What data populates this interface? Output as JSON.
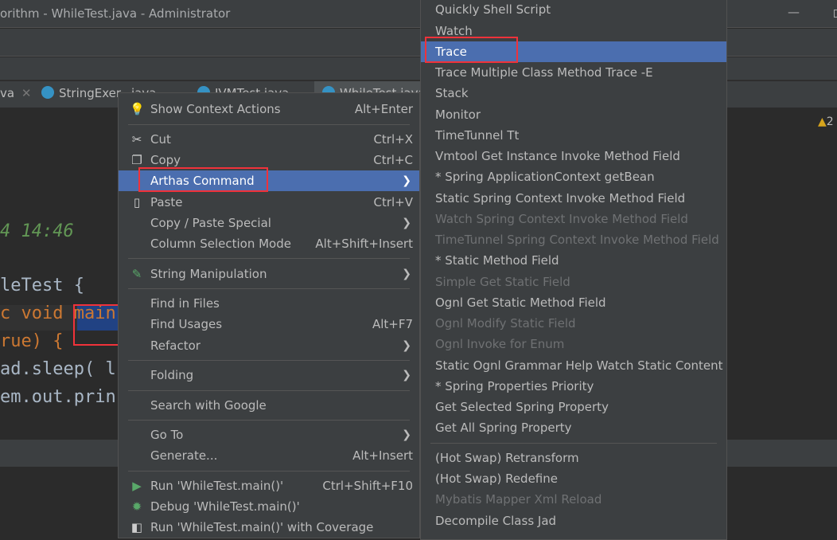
{
  "window": {
    "title": "orithm - WhileTest.java - Administrator",
    "minimize": "—"
  },
  "tabs": [
    {
      "label": "va",
      "close": "✕"
    },
    {
      "label": "StringExer...java",
      "close": "✕"
    },
    {
      "label": "JVMTest.java",
      "close": "✕"
    },
    {
      "label": "WhileTest.java"
    }
  ],
  "editor": {
    "warning_count": "2",
    "lines": [
      {
        "text": "4 14:46",
        "color": "#629755"
      },
      {
        "text": "leTest {",
        "color": "#a9b7c6"
      },
      {
        "text": "c void main",
        "color": "#cc7832"
      },
      {
        "text": "rue) {",
        "color": "#cc7832"
      },
      {
        "text": "ad.sleep( l",
        "color": "#a9b7c6"
      },
      {
        "text": "em.out.prin",
        "color": "#a9b7c6"
      }
    ]
  },
  "context_menu": {
    "items": [
      {
        "label": "Show Context Actions",
        "shortcut": "Alt+Enter",
        "icon": "lightbulb-icon"
      },
      {
        "separator": true
      },
      {
        "label": "Cut",
        "shortcut": "Ctrl+X",
        "icon": "scissors-icon"
      },
      {
        "label": "Copy",
        "shortcut": "Ctrl+C",
        "icon": "copy-icon"
      },
      {
        "label": "Arthas Command",
        "submenu": true,
        "selected": true
      },
      {
        "label": "Paste",
        "shortcut": "Ctrl+V",
        "icon": "clipboard-icon"
      },
      {
        "label": "Copy / Paste Special",
        "submenu": true
      },
      {
        "label": "Column Selection Mode",
        "shortcut": "Alt+Shift+Insert"
      },
      {
        "separator": true
      },
      {
        "label": "String Manipulation",
        "submenu": true,
        "icon": "pencil-icon"
      },
      {
        "separator": true
      },
      {
        "label": "Find in Files"
      },
      {
        "label": "Find Usages",
        "shortcut": "Alt+F7"
      },
      {
        "label": "Refactor",
        "submenu": true
      },
      {
        "separator": true
      },
      {
        "label": "Folding",
        "submenu": true
      },
      {
        "separator": true
      },
      {
        "label": "Search with Google"
      },
      {
        "separator": true
      },
      {
        "label": "Go To",
        "submenu": true
      },
      {
        "label": "Generate...",
        "shortcut": "Alt+Insert"
      },
      {
        "separator": true
      },
      {
        "label": "Run 'WhileTest.main()'",
        "shortcut": "Ctrl+Shift+F10",
        "icon": "run-icon"
      },
      {
        "label": "Debug 'WhileTest.main()'",
        "icon": "debug-icon"
      },
      {
        "label": "Run 'WhileTest.main()' with Coverage",
        "icon": "coverage-icon"
      }
    ]
  },
  "arthas_submenu": {
    "items": [
      {
        "label": "Quickly Shell Script"
      },
      {
        "label": "Watch"
      },
      {
        "label": "Trace",
        "selected": true
      },
      {
        "label": "Trace Multiple Class Method Trace -E"
      },
      {
        "label": "Stack"
      },
      {
        "label": "Monitor"
      },
      {
        "label": "TimeTunnel Tt"
      },
      {
        "label": "Vmtool Get Instance Invoke Method Field"
      },
      {
        "label": "* Spring ApplicationContext getBean"
      },
      {
        "label": "Static Spring Context Invoke  Method Field"
      },
      {
        "label": "Watch Spring Context Invoke Method Field",
        "disabled": true
      },
      {
        "label": "TimeTunnel Spring Context Invoke Method Field",
        "disabled": true
      },
      {
        "label": "*  Static Method Field"
      },
      {
        "label": "Simple Get Static Field",
        "disabled": true
      },
      {
        "label": "Ognl Get Static Method Field"
      },
      {
        "label": "Ognl Modify Static Field",
        "disabled": true
      },
      {
        "label": "Ognl Invoke for Enum",
        "disabled": true
      },
      {
        "label": "Static Ognl Grammar Help Watch Static Content"
      },
      {
        "label": "*  Spring Properties Priority"
      },
      {
        "label": "Get Selected Spring Property"
      },
      {
        "label": "Get All Spring Property"
      },
      {
        "separator": true
      },
      {
        "label": "(Hot Swap) Retransform"
      },
      {
        "label": "(Hot Swap) Redefine"
      },
      {
        "label": "Mybatis Mapper Xml Reload",
        "disabled": true
      },
      {
        "label": "Decompile Class Jad"
      }
    ]
  },
  "colors": {
    "highlight": "#4b6eaf",
    "annotation_box": "#f0323a",
    "menu_bg": "#3c3f41",
    "editor_bg": "#2b2b2b"
  }
}
